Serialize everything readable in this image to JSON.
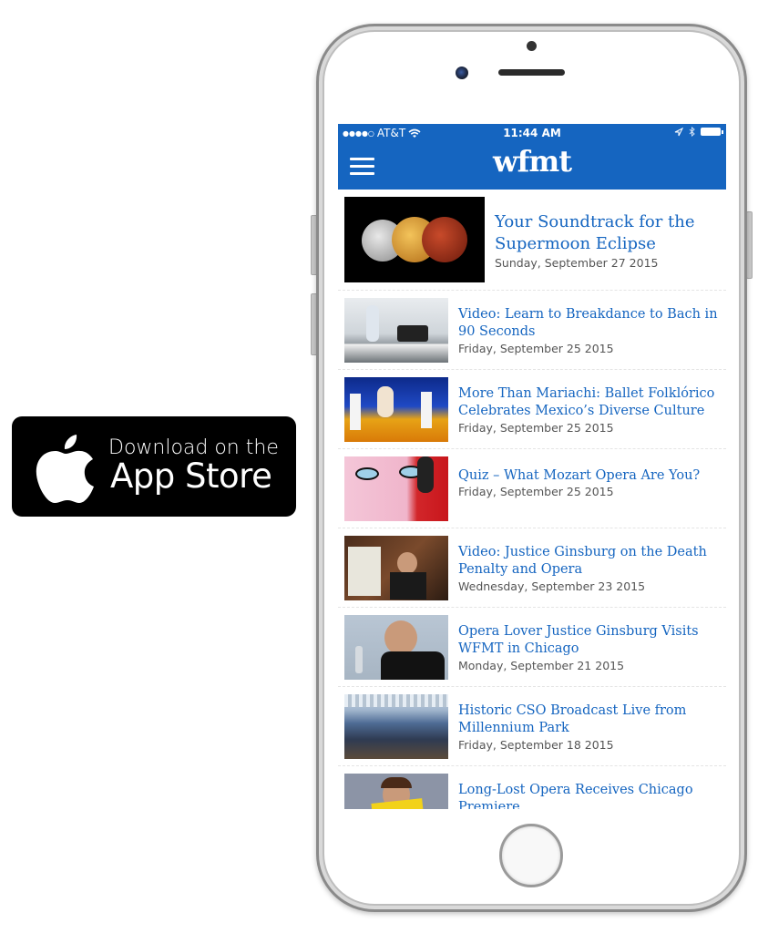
{
  "badge": {
    "line1": "Download on the",
    "line2": "App Store",
    "icon": "apple-logo-icon"
  },
  "status_bar": {
    "signal": "●●●●○",
    "carrier": "AT&T",
    "wifi_icon": "wifi-icon",
    "time": "11:44 AM",
    "location_icon": "location-arrow-icon",
    "bluetooth_icon": "bluetooth-icon",
    "battery_icon": "battery-icon"
  },
  "app_bar": {
    "menu_icon": "hamburger-menu-icon",
    "logo": "wfmt",
    "color": "#1565c0"
  },
  "featured": {
    "title": "Your Soundtrack for the Supermoon Eclipse",
    "date": "Sunday, September 27 2015",
    "image": "supermoon-eclipse-image"
  },
  "articles": [
    {
      "title": "Video: Learn to Breakdance to Bach in 90 Seconds",
      "date": "Friday, September 25 2015",
      "image": "breakdance-piano-image"
    },
    {
      "title": "More Than Mariachi: Ballet Folklórico Celebrates Mexico’s Diverse Culture",
      "date": "Friday, September 25 2015",
      "image": "ballet-folklorico-image"
    },
    {
      "title": "Quiz – What Mozart Opera Are You?",
      "date": "Friday, September 25 2015",
      "image": "mozart-illustration-image"
    },
    {
      "title": "Video: Justice Ginsburg on the Death Penalty and Opera",
      "date": "Wednesday, September 23 2015",
      "image": "ginsburg-studio-image"
    },
    {
      "title": "Opera Lover Justice Ginsburg Visits WFMT in Chicago",
      "date": "Monday, September 21 2015",
      "image": "ginsburg-visit-image"
    },
    {
      "title": "Historic CSO Broadcast Live from Millennium Park",
      "date": "Friday, September 18 2015",
      "image": "millennium-park-image"
    },
    {
      "title": "Long-Lost Opera Receives Chicago Premiere",
      "date": "",
      "image": "opera-score-reader-image"
    }
  ]
}
